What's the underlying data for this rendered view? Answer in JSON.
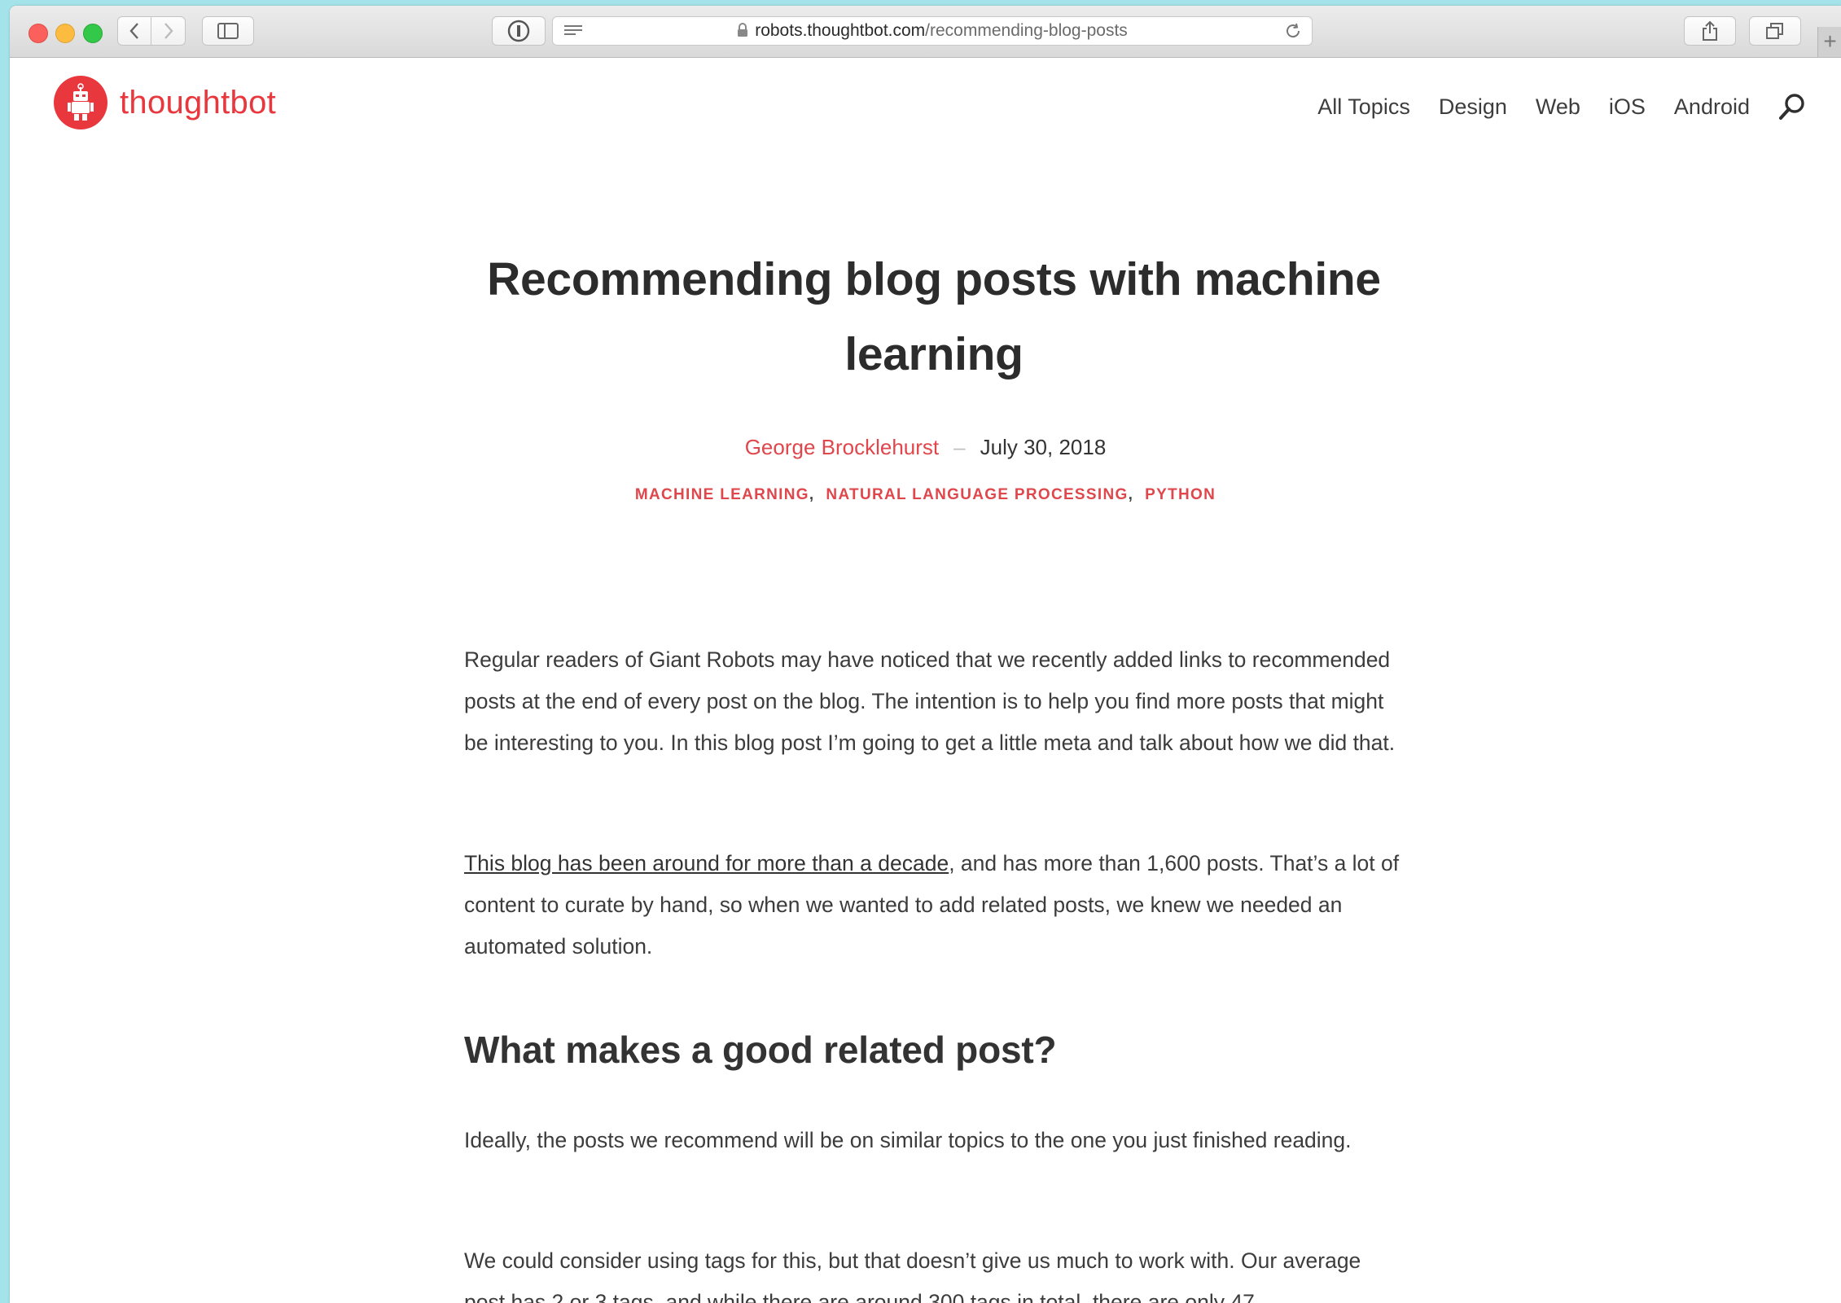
{
  "browser": {
    "url_host": "robots.thoughtbot.com",
    "url_path": "/recommending-blog-posts",
    "new_tab_label": "+"
  },
  "site": {
    "logo_text": "thoughtbot",
    "brand_color": "#e8373d",
    "nav": [
      "All Topics",
      "Design",
      "Web",
      "iOS",
      "Android"
    ]
  },
  "article": {
    "title": "Recommending blog posts with machine learning",
    "author": "George Brocklehurst",
    "separator": "–",
    "date": "July 30, 2018",
    "tags": [
      "MACHINE LEARNING",
      "NATURAL LANGUAGE PROCESSING",
      "PYTHON"
    ],
    "paragraph1": "Regular readers of Giant Robots may have noticed that we recently added links to recommended posts at the end of every post on the blog. The intention is to help you find more posts that might be interesting to you. In this blog post I’m going to get a little meta and talk about how we did that.",
    "paragraph2_link": "This blog has been around for more than a decade",
    "paragraph2_rest": ", and has more than 1,600 posts. That’s a lot of content to curate by hand, so when we wanted to add related posts, we knew we needed an automated solution.",
    "heading2": "What makes a good related post?",
    "paragraph3": "Ideally, the posts we recommend will be on similar topics to the one you just finished reading.",
    "paragraph4": "We could consider using tags for this, but that doesn’t give us much to work with. Our average post has 2 or 3 tags, and while there are around 300 tags in total, there are only 47"
  }
}
